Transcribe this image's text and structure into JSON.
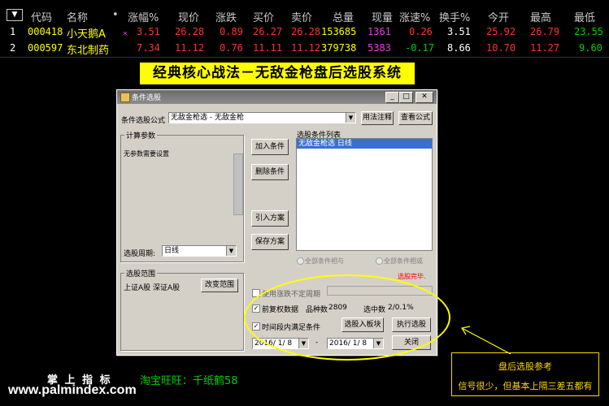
{
  "quote_table": {
    "selector_icon": "▼",
    "headers": [
      "代码",
      "名称",
      "•",
      "涨幅%",
      "现价",
      "涨跌",
      "买价",
      "卖价",
      "总量",
      "现量",
      "涨速%",
      "换手%",
      "今开",
      "最高",
      "最低"
    ],
    "rows": [
      {
        "index": "1",
        "code": "000418",
        "name": "小天鹅A",
        "mark": "×",
        "change_pct": "3.51",
        "price": "26.28",
        "change": "0.89",
        "bid": "26.27",
        "ask": "26.28",
        "volume": "153685",
        "cur_vol": "1361",
        "speed": "0.26",
        "turnover": "3.51",
        "open": "25.92",
        "high": "26.79",
        "low": "23.55"
      },
      {
        "index": "2",
        "code": "000597",
        "name": "东北制药",
        "mark": "",
        "change_pct": "7.34",
        "price": "11.12",
        "change": "0.76",
        "bid": "11.11",
        "ask": "11.12",
        "volume": "379738",
        "cur_vol": "5383",
        "speed": "-0.17",
        "turnover": "8.66",
        "open": "10.70",
        "high": "11.27",
        "low": "9.60"
      }
    ]
  },
  "banner": {
    "text": "经典核心战法－无敌金枪盘后选股系统"
  },
  "dialog": {
    "title": "条件选股",
    "formula_label": "条件选股公式",
    "formula_value": "无敌金枪选  - 无敌金枪",
    "usage_button": "用法注释",
    "view_formula_button": "查看公式",
    "params_group": "计算参数",
    "params_text": "无参数需要设置",
    "period_label": "选股周期:",
    "period_value": "日线",
    "add_condition": "加入条件",
    "delete_condition": "删除条件",
    "import_plan": "引入方案",
    "save_plan": "保存方案",
    "conditions_list_label": "选股条件列表",
    "conditions_item": "无敌金枪选  日线",
    "radio_all_and": "全部条件相与",
    "radio_all_or": "全部条件相或",
    "done_text": "选股完毕.",
    "range_group": "选股范围",
    "range_text": "上证A股 深证A股",
    "change_range": "改变范围",
    "use_irregular_period": "使用涨跌不定周期",
    "pre_adjust": "前复权数据",
    "stock_count_label": "品种数",
    "stock_count": "2809",
    "selected_label": "选中数",
    "selected_value": "2/0.1%",
    "time_condition": "时间段内满足条件",
    "select_to_block": "选股入板块",
    "execute": "执行选股",
    "date_from": "2016/ 1/ 8",
    "date_sep": "-",
    "date_to": "2016/ 1/ 8",
    "close": "关闭"
  },
  "footer": {
    "brand": "掌 上 指 标",
    "taobao": "淘宝旺旺：千纸鹤58",
    "url": "www.palmindex.com"
  },
  "callout": {
    "title": "盘后选股参考",
    "note": "信号很少，但基本上隔三差五都有"
  },
  "colors": {
    "up_red": "#ff3030",
    "green": "#00d000",
    "yellow": "#ffff00",
    "magenta": "#e040e0",
    "header_gray": "#c8c8c8"
  }
}
